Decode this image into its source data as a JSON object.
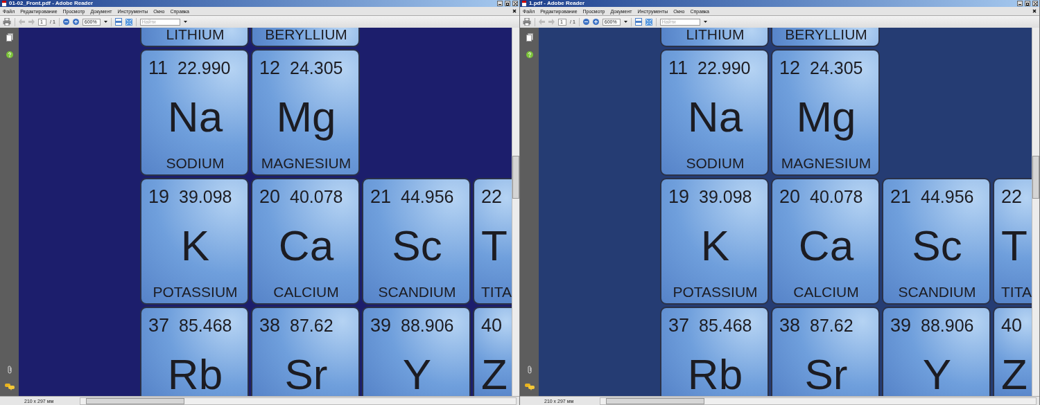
{
  "windows": [
    {
      "title": "01-02_Front.pdf - Adobe Reader",
      "menu": [
        "Файл",
        "Редактирование",
        "Просмотр",
        "Документ",
        "Инструменты",
        "Окно",
        "Справка"
      ],
      "toolbar": {
        "page": "1",
        "page_total": "/ 1",
        "zoom": "600%",
        "search_placeholder": "Найти"
      },
      "page_size": "210 x 297 мм",
      "color": "#1c1e6c",
      "rows": [
        [
          {
            "name": "LITHIUM"
          },
          {
            "name": "BERYLLIUM"
          }
        ],
        [
          {
            "number": "11",
            "weight": "22.990",
            "symbol": "Na",
            "name": "SODIUM"
          },
          {
            "number": "12",
            "weight": "24.305",
            "symbol": "Mg",
            "name": "MAGNESIUM"
          }
        ],
        [
          {
            "number": "19",
            "weight": "39.098",
            "symbol": "K",
            "name": "POTASSIUM"
          },
          {
            "number": "20",
            "weight": "40.078",
            "symbol": "Ca",
            "name": "CALCIUM"
          },
          {
            "number": "21",
            "weight": "44.956",
            "symbol": "Sc",
            "name": "SCANDIUM"
          },
          {
            "number": "22",
            "symbol": "T",
            "name": "TITA"
          }
        ],
        [
          {
            "number": "37",
            "weight": "85.468",
            "symbol": "Rb"
          },
          {
            "number": "38",
            "weight": "87.62",
            "symbol": "Sr"
          },
          {
            "number": "39",
            "weight": "88.906",
            "symbol": "Y"
          },
          {
            "number": "40",
            "symbol": "Z"
          }
        ]
      ]
    },
    {
      "title": "1.pdf - Adobe Reader",
      "menu": [
        "Файл",
        "Редактирование",
        "Просмотр",
        "Документ",
        "Инструменты",
        "Окно",
        "Справка"
      ],
      "toolbar": {
        "page": "1",
        "page_total": "/ 1",
        "zoom": "600%",
        "search_placeholder": "Найти"
      },
      "page_size": "210 x 297 мм",
      "color": "#253c73",
      "rows": [
        [
          {
            "name": "LITHIUM"
          },
          {
            "name": "BERYLLIUM"
          }
        ],
        [
          {
            "number": "11",
            "weight": "22.990",
            "symbol": "Na",
            "name": "SODIUM"
          },
          {
            "number": "12",
            "weight": "24.305",
            "symbol": "Mg",
            "name": "MAGNESIUM"
          }
        ],
        [
          {
            "number": "19",
            "weight": "39.098",
            "symbol": "K",
            "name": "POTASSIUM"
          },
          {
            "number": "20",
            "weight": "40.078",
            "symbol": "Ca",
            "name": "CALCIUM"
          },
          {
            "number": "21",
            "weight": "44.956",
            "symbol": "Sc",
            "name": "SCANDIUM"
          },
          {
            "number": "22",
            "symbol": "T",
            "name": "TITA"
          }
        ],
        [
          {
            "number": "37",
            "weight": "85.468",
            "symbol": "Rb"
          },
          {
            "number": "38",
            "weight": "87.62",
            "symbol": "Sr"
          },
          {
            "number": "39",
            "weight": "88.906",
            "symbol": "Y"
          },
          {
            "number": "40",
            "symbol": "Z"
          }
        ]
      ]
    }
  ]
}
